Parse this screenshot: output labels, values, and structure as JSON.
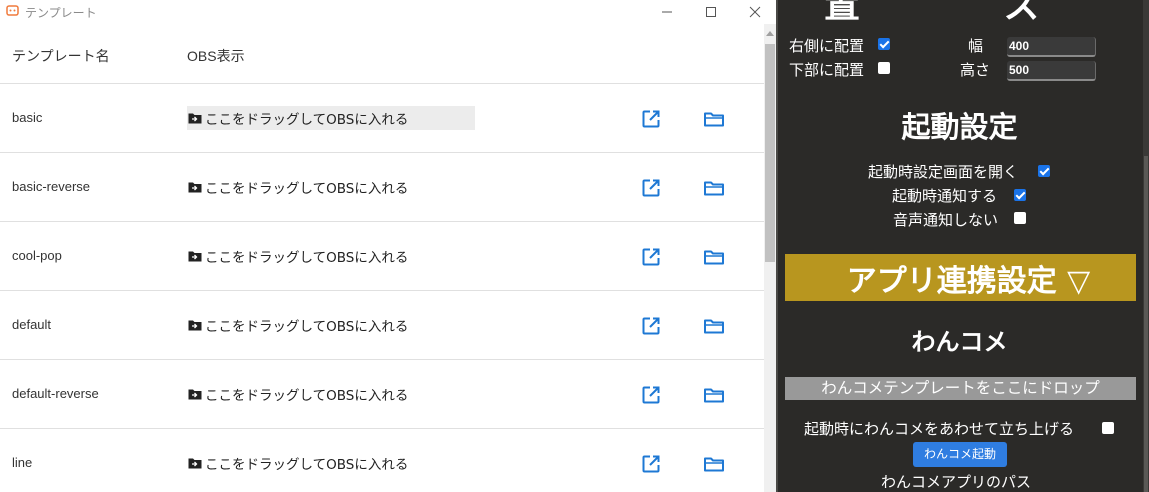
{
  "window": {
    "title": "テンプレート",
    "icons": {
      "app": "app-logo-icon",
      "minimize": "minimize-icon",
      "maximize": "maximize-icon",
      "close": "close-icon"
    }
  },
  "table": {
    "columns": [
      "テンプレート名",
      "OBS表示"
    ],
    "drag_label": "ここをドラッグしてOBSに入れる",
    "rows": [
      {
        "name": "basic"
      },
      {
        "name": "basic-reverse"
      },
      {
        "name": "cool-pop"
      },
      {
        "name": "default"
      },
      {
        "name": "default-reverse"
      },
      {
        "name": "line"
      }
    ],
    "row_icons": [
      "drag-folder-icon",
      "open-external-icon",
      "folder-icon"
    ]
  },
  "panel": {
    "top_cut_glyphs": [
      "置",
      "ズ"
    ],
    "position": {
      "right_label": "右側に配置",
      "right_checked": true,
      "bottom_label": "下部に配置",
      "bottom_checked": false,
      "width_label": "幅",
      "width_value": "400",
      "height_label": "高さ",
      "height_value": "500"
    },
    "startup": {
      "heading": "起動設定",
      "open_settings_label": "起動時設定画面を開く",
      "open_settings_checked": true,
      "notify_label": "起動時通知する",
      "notify_checked": true,
      "mute_label": "音声通知しない",
      "mute_checked": false
    },
    "app_link": {
      "bar_label": "アプリ連携設定 ▽",
      "accent": "#b8961f"
    },
    "onecome": {
      "heading": "わんコメ",
      "drop_label": "わんコメテンプレートをここにドロップ",
      "launch_together_label": "起動時にわんコメをあわせて立ち上げる",
      "launch_together_checked": false,
      "launch_button": "わんコメ起動",
      "path_label": "わんコメアプリのパス"
    }
  }
}
